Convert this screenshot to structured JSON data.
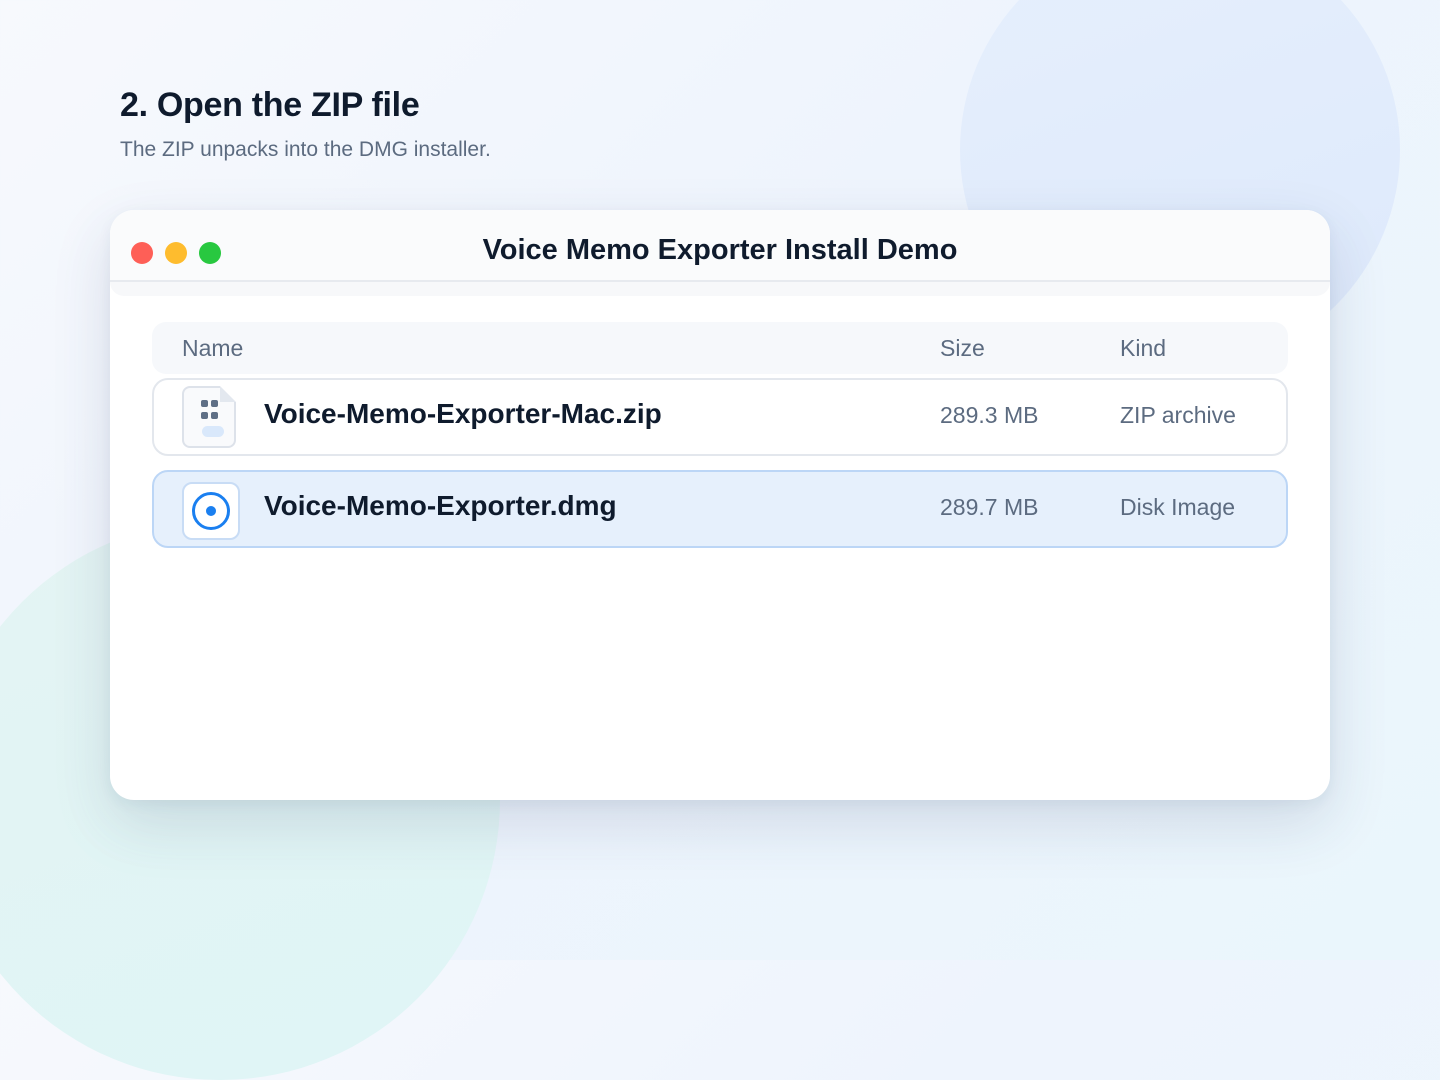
{
  "page": {
    "heading": "2. Open the ZIP file",
    "subtitle": "The ZIP unpacks into the DMG installer."
  },
  "window": {
    "title": "Voice Memo Exporter Install Demo",
    "traffic_lights": [
      "close",
      "minimize",
      "maximize"
    ]
  },
  "file_list": {
    "columns": [
      "Name",
      "Size",
      "Kind"
    ],
    "rows": [
      {
        "name": "Voice-Memo-Exporter-Mac.zip",
        "size": "289.3 MB",
        "kind": "ZIP archive",
        "icon": "zip-archive-icon",
        "selected": false
      },
      {
        "name": "Voice-Memo-Exporter.dmg",
        "size": "289.7 MB",
        "kind": "Disk Image",
        "icon": "disk-image-icon",
        "selected": true
      }
    ]
  },
  "colors": {
    "accent": "#1a7ff0",
    "selected_row": "#e6f0fc",
    "traffic_red": "#fe5f57",
    "traffic_yellow": "#febc2e",
    "traffic_green": "#28c840"
  }
}
